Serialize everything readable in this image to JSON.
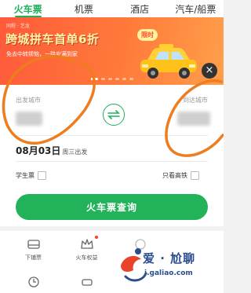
{
  "tabs": [
    {
      "label": "火车票",
      "active": true
    },
    {
      "label": "机票",
      "active": false
    },
    {
      "label": "酒店",
      "active": false
    },
    {
      "label": "汽车/船票",
      "active": false
    }
  ],
  "banner": {
    "tag": "同程 · 艺龙",
    "title": "跨城拼车首单6折",
    "limit_badge": "限时",
    "subtitle": "免去中转烦恼，一路安满到家",
    "close": "×"
  },
  "search": {
    "from_label": "出发城市",
    "to_label": "到达城市",
    "date": "08月03日",
    "weekday": "周三出发",
    "student_label": "学生票",
    "highspeed_label": "只看高铁",
    "query_button": "火车票查询"
  },
  "quick": {
    "row1": [
      {
        "label": "下铺票",
        "icon": "bed-ticket-icon"
      },
      {
        "label": "火车权益",
        "icon": "crown-icon",
        "dot": true
      },
      {
        "label": "",
        "icon": "service-icon"
      },
      {
        "label": "",
        "icon": "more-icon"
      }
    ]
  },
  "watermark": {
    "text": "爱 · 尬聊",
    "url": "i.galiao.com"
  },
  "colors": {
    "accent": "#1fb05a",
    "banner": "#ff6a3a",
    "annotation": "#ee7d1f"
  }
}
